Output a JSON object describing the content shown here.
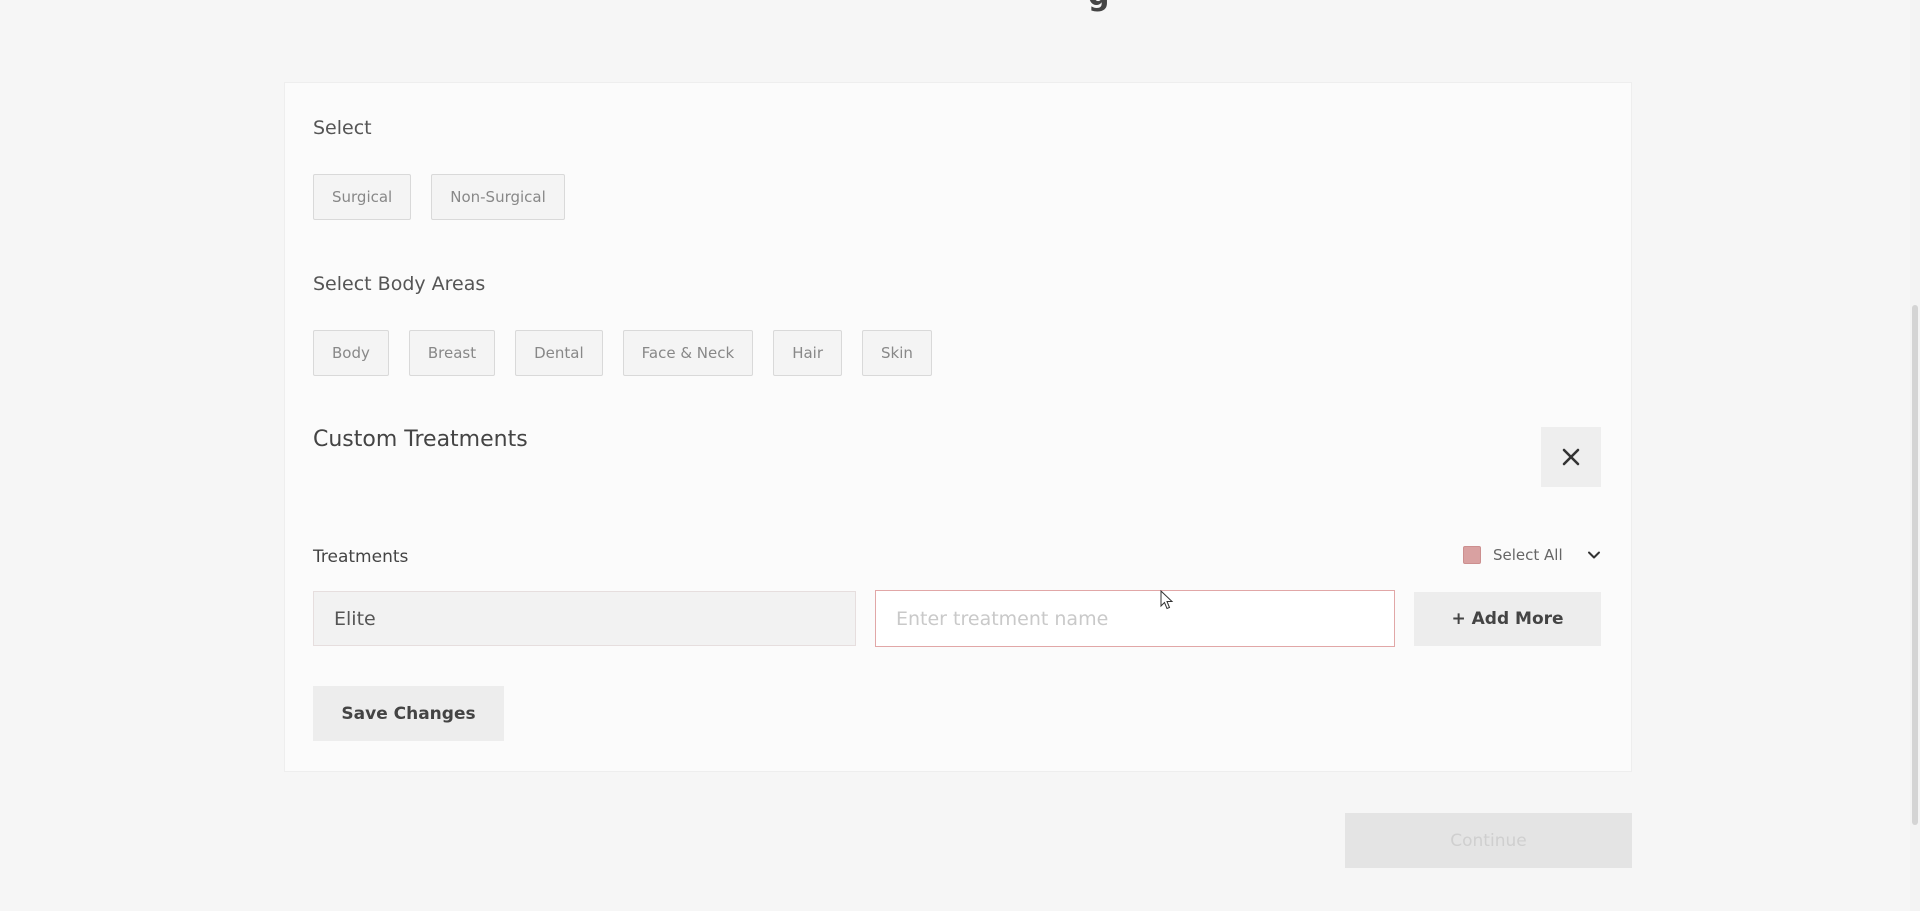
{
  "top_fragment": "g",
  "select_section": {
    "label": "Select",
    "options": [
      "Surgical",
      "Non-Surgical"
    ]
  },
  "body_areas_section": {
    "label": "Select Body Areas",
    "options": [
      "Body",
      "Breast",
      "Dental",
      "Face & Neck",
      "Hair",
      "Skin"
    ]
  },
  "custom_treatments": {
    "title": "Custom Treatments",
    "close_icon": "close-icon",
    "treatments_label": "Treatments",
    "select_all_label": "Select All",
    "checkbox_color": "#d9a1a1",
    "existing_value": "Elite",
    "new_placeholder": "Enter treatment name",
    "add_more_label": "+ Add More",
    "save_label": "Save Changes"
  },
  "footer": {
    "continue_label": "Continue"
  },
  "colors": {
    "accent_border": "#e1a7a7",
    "background": "#f6f6f6"
  }
}
